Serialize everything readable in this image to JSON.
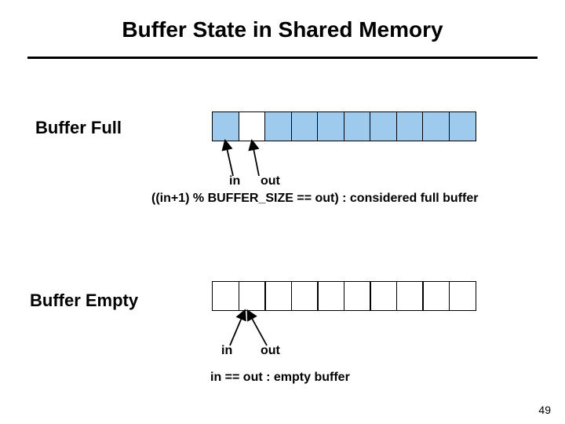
{
  "title": "Buffer State in Shared Memory",
  "full": {
    "label": "Buffer Full",
    "in_label": "in",
    "out_label": "out",
    "formula": "((in+1) % BUFFER_SIZE == out) : considered full buffer"
  },
  "empty": {
    "label": "Buffer Empty",
    "in_label": "in",
    "out_label": "out",
    "formula": "in == out : empty buffer"
  },
  "page_number": "49"
}
